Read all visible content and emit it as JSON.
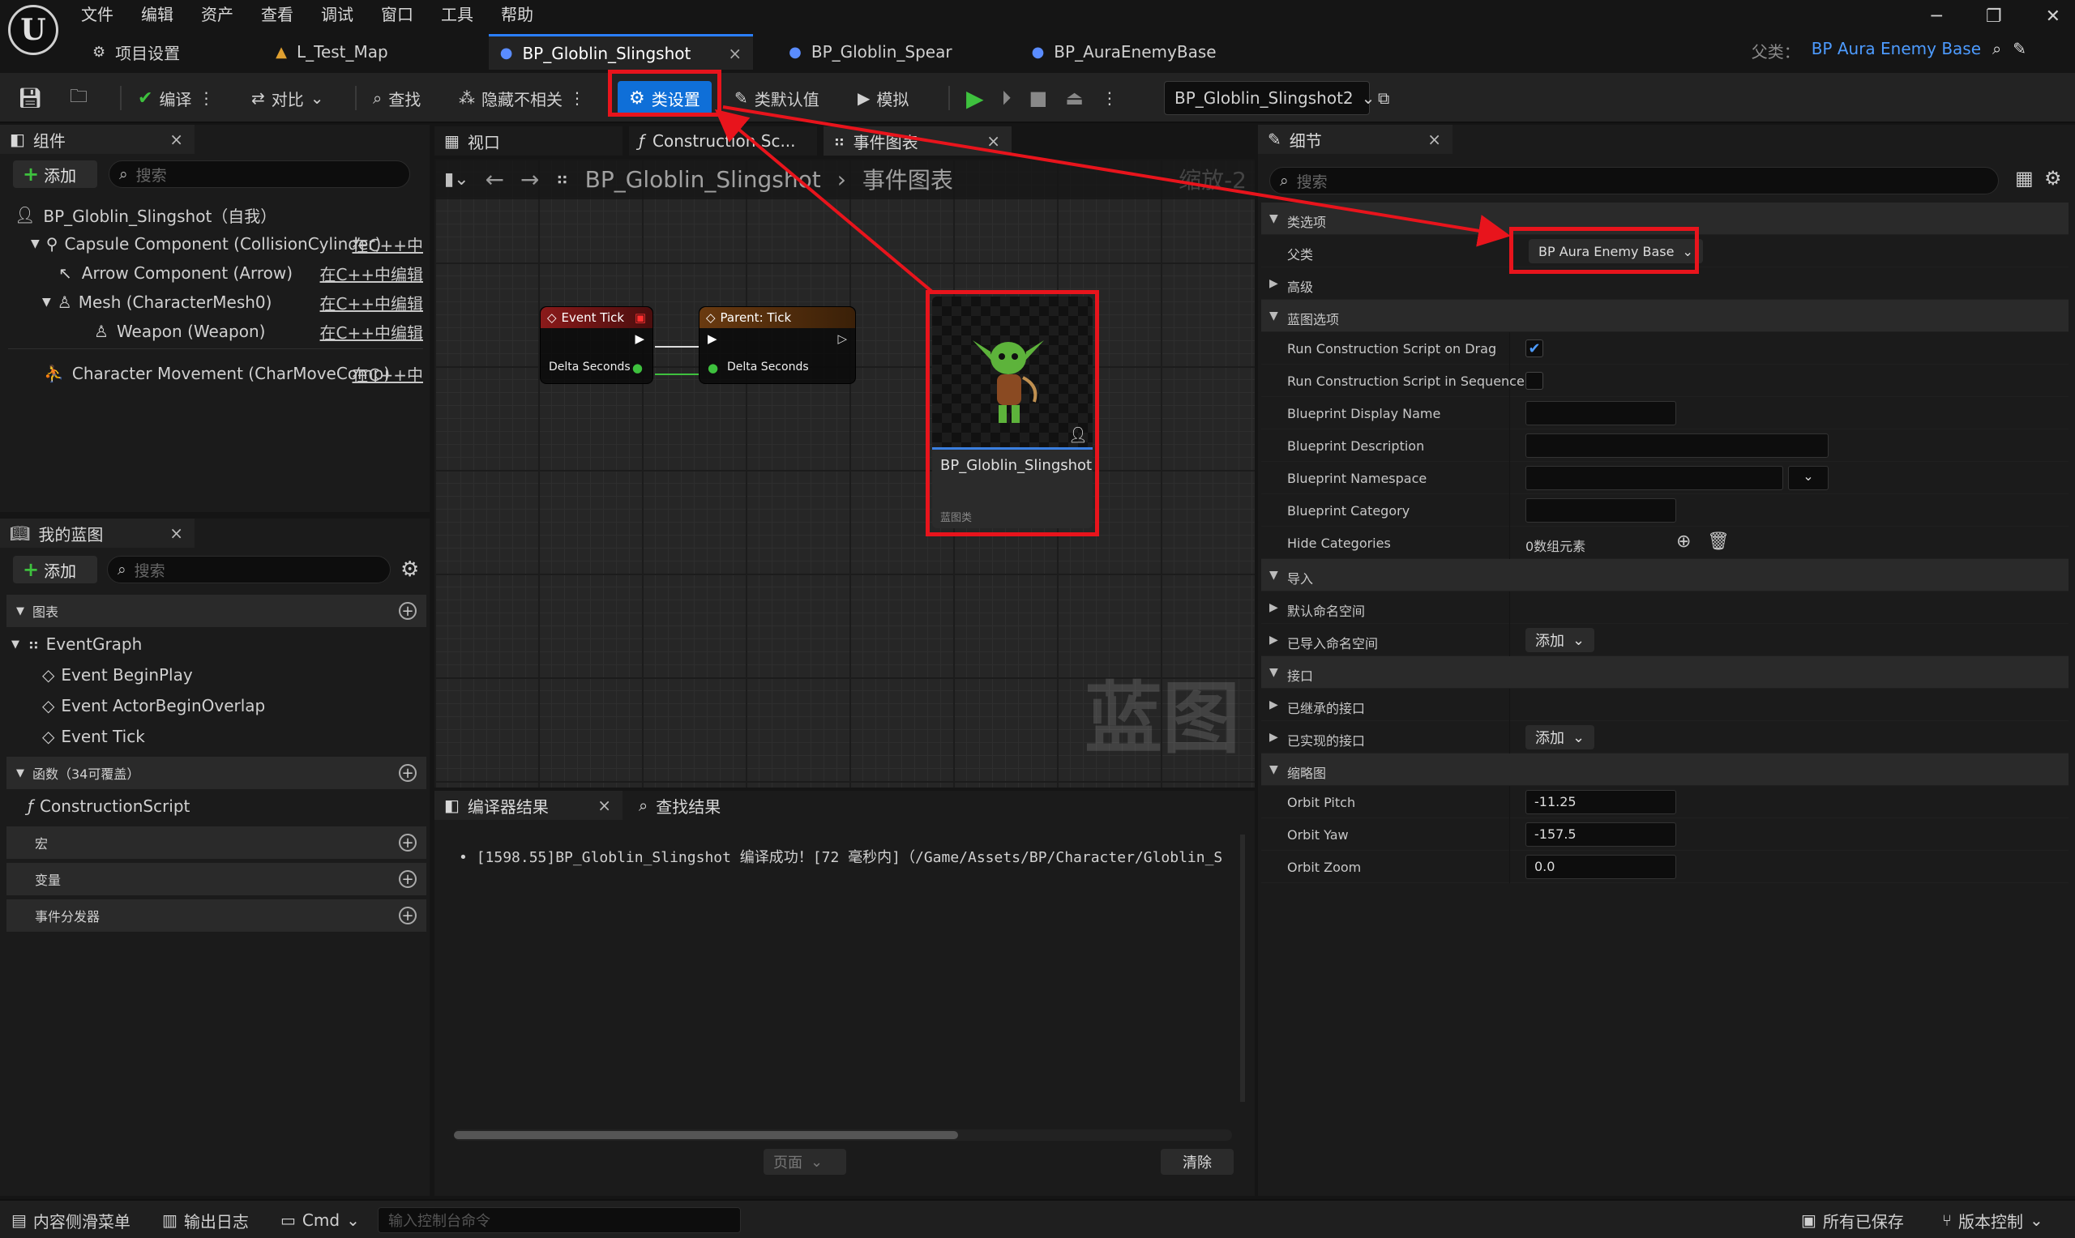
{
  "app": {
    "logo": "U",
    "menu": [
      "文件",
      "编辑",
      "资产",
      "查看",
      "调试",
      "窗口",
      "工具",
      "帮助"
    ]
  },
  "window_controls": {
    "minimize": "─",
    "restore": "❐",
    "close": "✕"
  },
  "tabs": [
    {
      "label": "项目设置",
      "icon": "gear-icon"
    },
    {
      "label": "L_Test_Map",
      "icon": "map-icon"
    },
    {
      "label": "BP_Globlin_Slingshot",
      "icon": "blueprint-icon",
      "close": "×"
    },
    {
      "label": "BP_Globlin_Spear",
      "icon": "blueprint-icon"
    },
    {
      "label": "BP_AuraEnemyBase",
      "icon": "blueprint-icon"
    }
  ],
  "parent_class": {
    "label": "父类：",
    "value": "BP Aura Enemy Base"
  },
  "toolbar": {
    "compile": "编译",
    "diff": "对比",
    "find": "查找",
    "hide_unrelated": "隐藏不相关",
    "class_settings": "类设置",
    "class_defaults": "类默认值",
    "simulate": "模拟",
    "debug_object": "BP_Globlin_Slingshot2"
  },
  "components": {
    "title": "组件",
    "add": "添加",
    "search_placeholder": "搜索",
    "items": [
      {
        "label": "BP_Globlin_Slingshot（自我）",
        "edit": ""
      },
      {
        "label": "Capsule Component (CollisionCylinder)",
        "edit": "在C++中"
      },
      {
        "label": "Arrow Component (Arrow)",
        "edit": "在C++中编辑"
      },
      {
        "label": "Mesh (CharacterMesh0)",
        "edit": "在C++中编辑"
      },
      {
        "label": "Weapon (Weapon)",
        "edit": "在C++中编辑"
      },
      {
        "label": "Character Movement (CharMoveComp)",
        "edit": "在C++中"
      }
    ]
  },
  "my_blueprint": {
    "title": "我的蓝图",
    "add": "添加",
    "search_placeholder": "搜索",
    "graphs_label": "图表",
    "event_graph": "EventGraph",
    "events": [
      "Event BeginPlay",
      "Event ActorBeginOverlap",
      "Event Tick"
    ],
    "functions_label": "函数（34可覆盖）",
    "construction_script": "ConstructionScript",
    "macros_label": "宏",
    "variables_label": "变量",
    "dispatchers_label": "事件分发器"
  },
  "graph": {
    "tabs": [
      "视口",
      "Construction Sc...",
      "事件图表"
    ],
    "breadcrumb_bp": "BP_Globlin_Slingshot",
    "breadcrumb_sep": "›",
    "breadcrumb_graph": "事件图表",
    "zoom": "缩放-2",
    "watermark": "蓝图",
    "node_event_tick": {
      "title": "Event Tick",
      "pin": "Delta Seconds"
    },
    "node_parent_tick": {
      "title": "Parent: Tick",
      "pin": "Delta Seconds"
    },
    "asset_card": {
      "name": "BP_Globlin_Slingshot",
      "type": "蓝图类"
    }
  },
  "compiler": {
    "title": "编译器结果",
    "find_results": "查找结果",
    "message": "[1598.55]BP_Globlin_Slingshot 编译成功！[72 毫秒内]（/Game/Assets/BP/Character/Globlin_S",
    "page": "页面",
    "clear": "清除"
  },
  "details": {
    "title": "细节",
    "search_placeholder": "搜索",
    "sections": {
      "class_options": "类选项",
      "parent_class": "父类",
      "parent_class_value": "BP Aura Enemy Base",
      "advanced": "高级",
      "bp_options": "蓝图选项",
      "run_drag": "Run Construction Script on Drag",
      "run_drag_checked": true,
      "run_seq": "Run Construction Script in Sequencer",
      "run_seq_checked": false,
      "display_name": "Blueprint Display Name",
      "description": "Blueprint Description",
      "namespace": "Blueprint Namespace",
      "category": "Blueprint Category",
      "hide_categories": "Hide Categories",
      "hide_categories_value": "0数组元素",
      "imports": "导入",
      "default_ns": "默认命名空间",
      "imported_ns": "已导入命名空间",
      "add": "添加",
      "interfaces": "接口",
      "inherited": "已继承的接口",
      "implemented": "已实现的接口",
      "thumbnail": "缩略图",
      "orbit_pitch": "Orbit Pitch",
      "orbit_pitch_value": "-11.25",
      "orbit_yaw": "Orbit Yaw",
      "orbit_yaw_value": "-157.5",
      "orbit_zoom": "Orbit Zoom",
      "orbit_zoom_value": "0.0"
    }
  },
  "status_bar": {
    "content_drawer": "内容侧滑菜单",
    "output_log": "输出日志",
    "cmd": "Cmd",
    "console_placeholder": "输入控制台命令",
    "all_saved": "所有已保存",
    "source_control": "版本控制"
  },
  "colors": {
    "accent": "#0f6fd8",
    "highlight": "#e8141c",
    "event_node": "#8a1a1a",
    "parent_node": "#6a3a10"
  }
}
